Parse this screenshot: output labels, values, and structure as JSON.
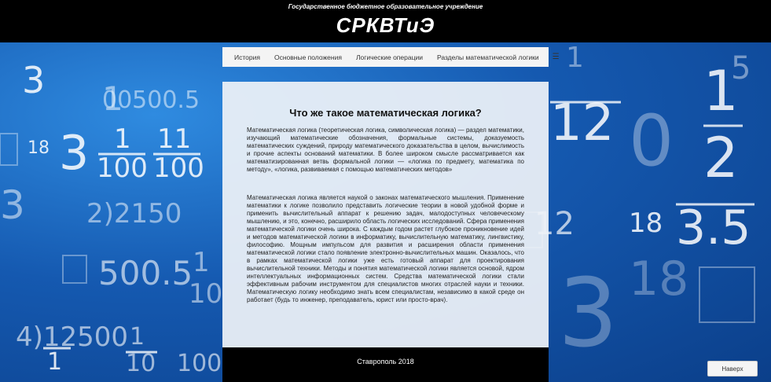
{
  "header": {
    "subtitle": "Государственное бюджетное образовательное учреждение",
    "logo": "СРКВТиЭ"
  },
  "nav": {
    "items": [
      {
        "label": "История"
      },
      {
        "label": "Основные положения"
      },
      {
        "label": "Логические операции"
      },
      {
        "label": "Разделы математической логики"
      }
    ],
    "menu_icon": "hamburger-icon",
    "menu_glyph": "☰"
  },
  "main": {
    "title": "Что же такое математическая логика?",
    "paragraph1": "Математическая логика (теоретическая логика, символическая логика) — раздел математики, изучающий математические обозначения, формальные системы, доказуемость математических суждений, природу математического доказательства в целом, вычислимость и прочие аспекты оснований математики. В более широком смысле рассматривается как математизированная ветвь формальной логики — «логика по предмету, математика по методу», «логика, развиваемая с помощью математических методов»",
    "paragraph2": "Математическая логика является наукой о законах математического мышления. Применение математики к логике позволило представить логические теории в новой удобной форме и применить вычислительный аппарат к решению задач, малодоступных человеческому мышлению, и это, конечно, расширило область логических исследований. Сфера применения математической логики очень широка. С каждым годом растет глубокое проникновение идей и методов математической логики в информатику, вычислительную математику, лингвистику, философию. Мощным импульсом для развития и расширения области применения математической логики стало появление электронно-вычислительных машин. Оказалось, что в рамках математической логики уже есть готовый аппарат для проектирования вычислительной техники. Методы и понятия математической логики является основой, ядром интеллектуальных информационных систем. Средства математической логики стали эффективным рабочим инструментом для специалистов многих отраслей науки и техники. Математическую логику необходимо знать всем специалистам, независимо в какой среде он работает (будь то инженер, преподаватель, юрист или просто-врач)."
  },
  "footer": {
    "text": "Ставрополь 2018"
  },
  "back_button": {
    "label": "Наверх"
  },
  "colors": {
    "header_bg": "#000000",
    "background_blue": "#1a5fb4",
    "panel_bg": "#eef2f7"
  }
}
